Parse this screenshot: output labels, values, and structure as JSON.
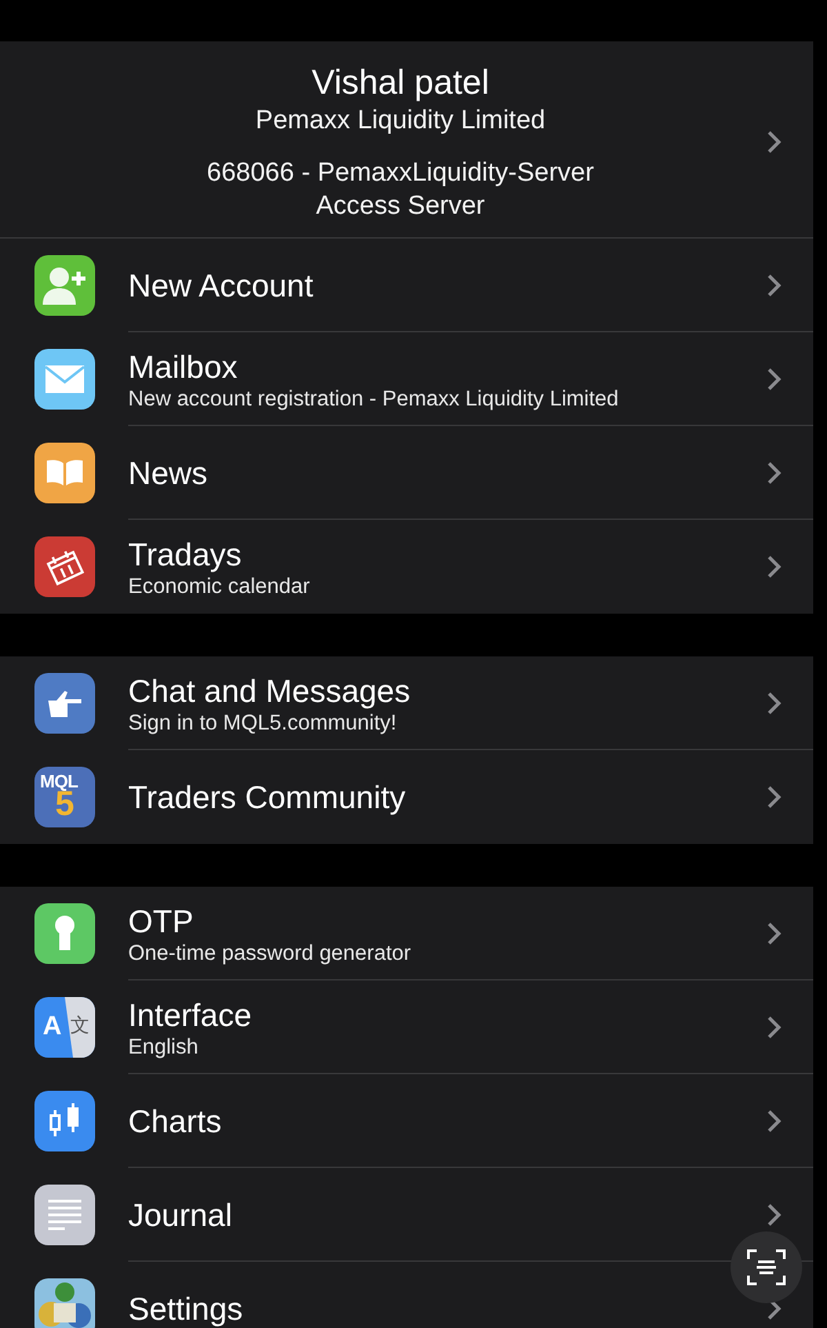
{
  "account": {
    "name": "Vishal patel",
    "company": "Pemaxx Liquidity Limited",
    "server": "668066 - PemaxxLiquidity-Server",
    "access": "Access Server"
  },
  "sections": [
    {
      "items": [
        {
          "title": "New Account"
        },
        {
          "title": "Mailbox",
          "subtitle": "New account registration - Pemaxx Liquidity Limited"
        },
        {
          "title": "News"
        },
        {
          "title": "Tradays",
          "subtitle": "Economic calendar"
        }
      ]
    },
    {
      "items": [
        {
          "title": "Chat and Messages",
          "subtitle": "Sign in to MQL5.community!"
        },
        {
          "logo_text": "MQL",
          "logo_digit": "5",
          "title": "Traders Community"
        }
      ]
    },
    {
      "items": [
        {
          "title": "OTP",
          "subtitle": "One-time password generator"
        },
        {
          "glyphs": [
            "A",
            "文"
          ],
          "title": "Interface",
          "subtitle": "English"
        },
        {
          "title": "Charts"
        },
        {
          "title": "Journal"
        },
        {
          "title": "Settings"
        }
      ]
    }
  ]
}
